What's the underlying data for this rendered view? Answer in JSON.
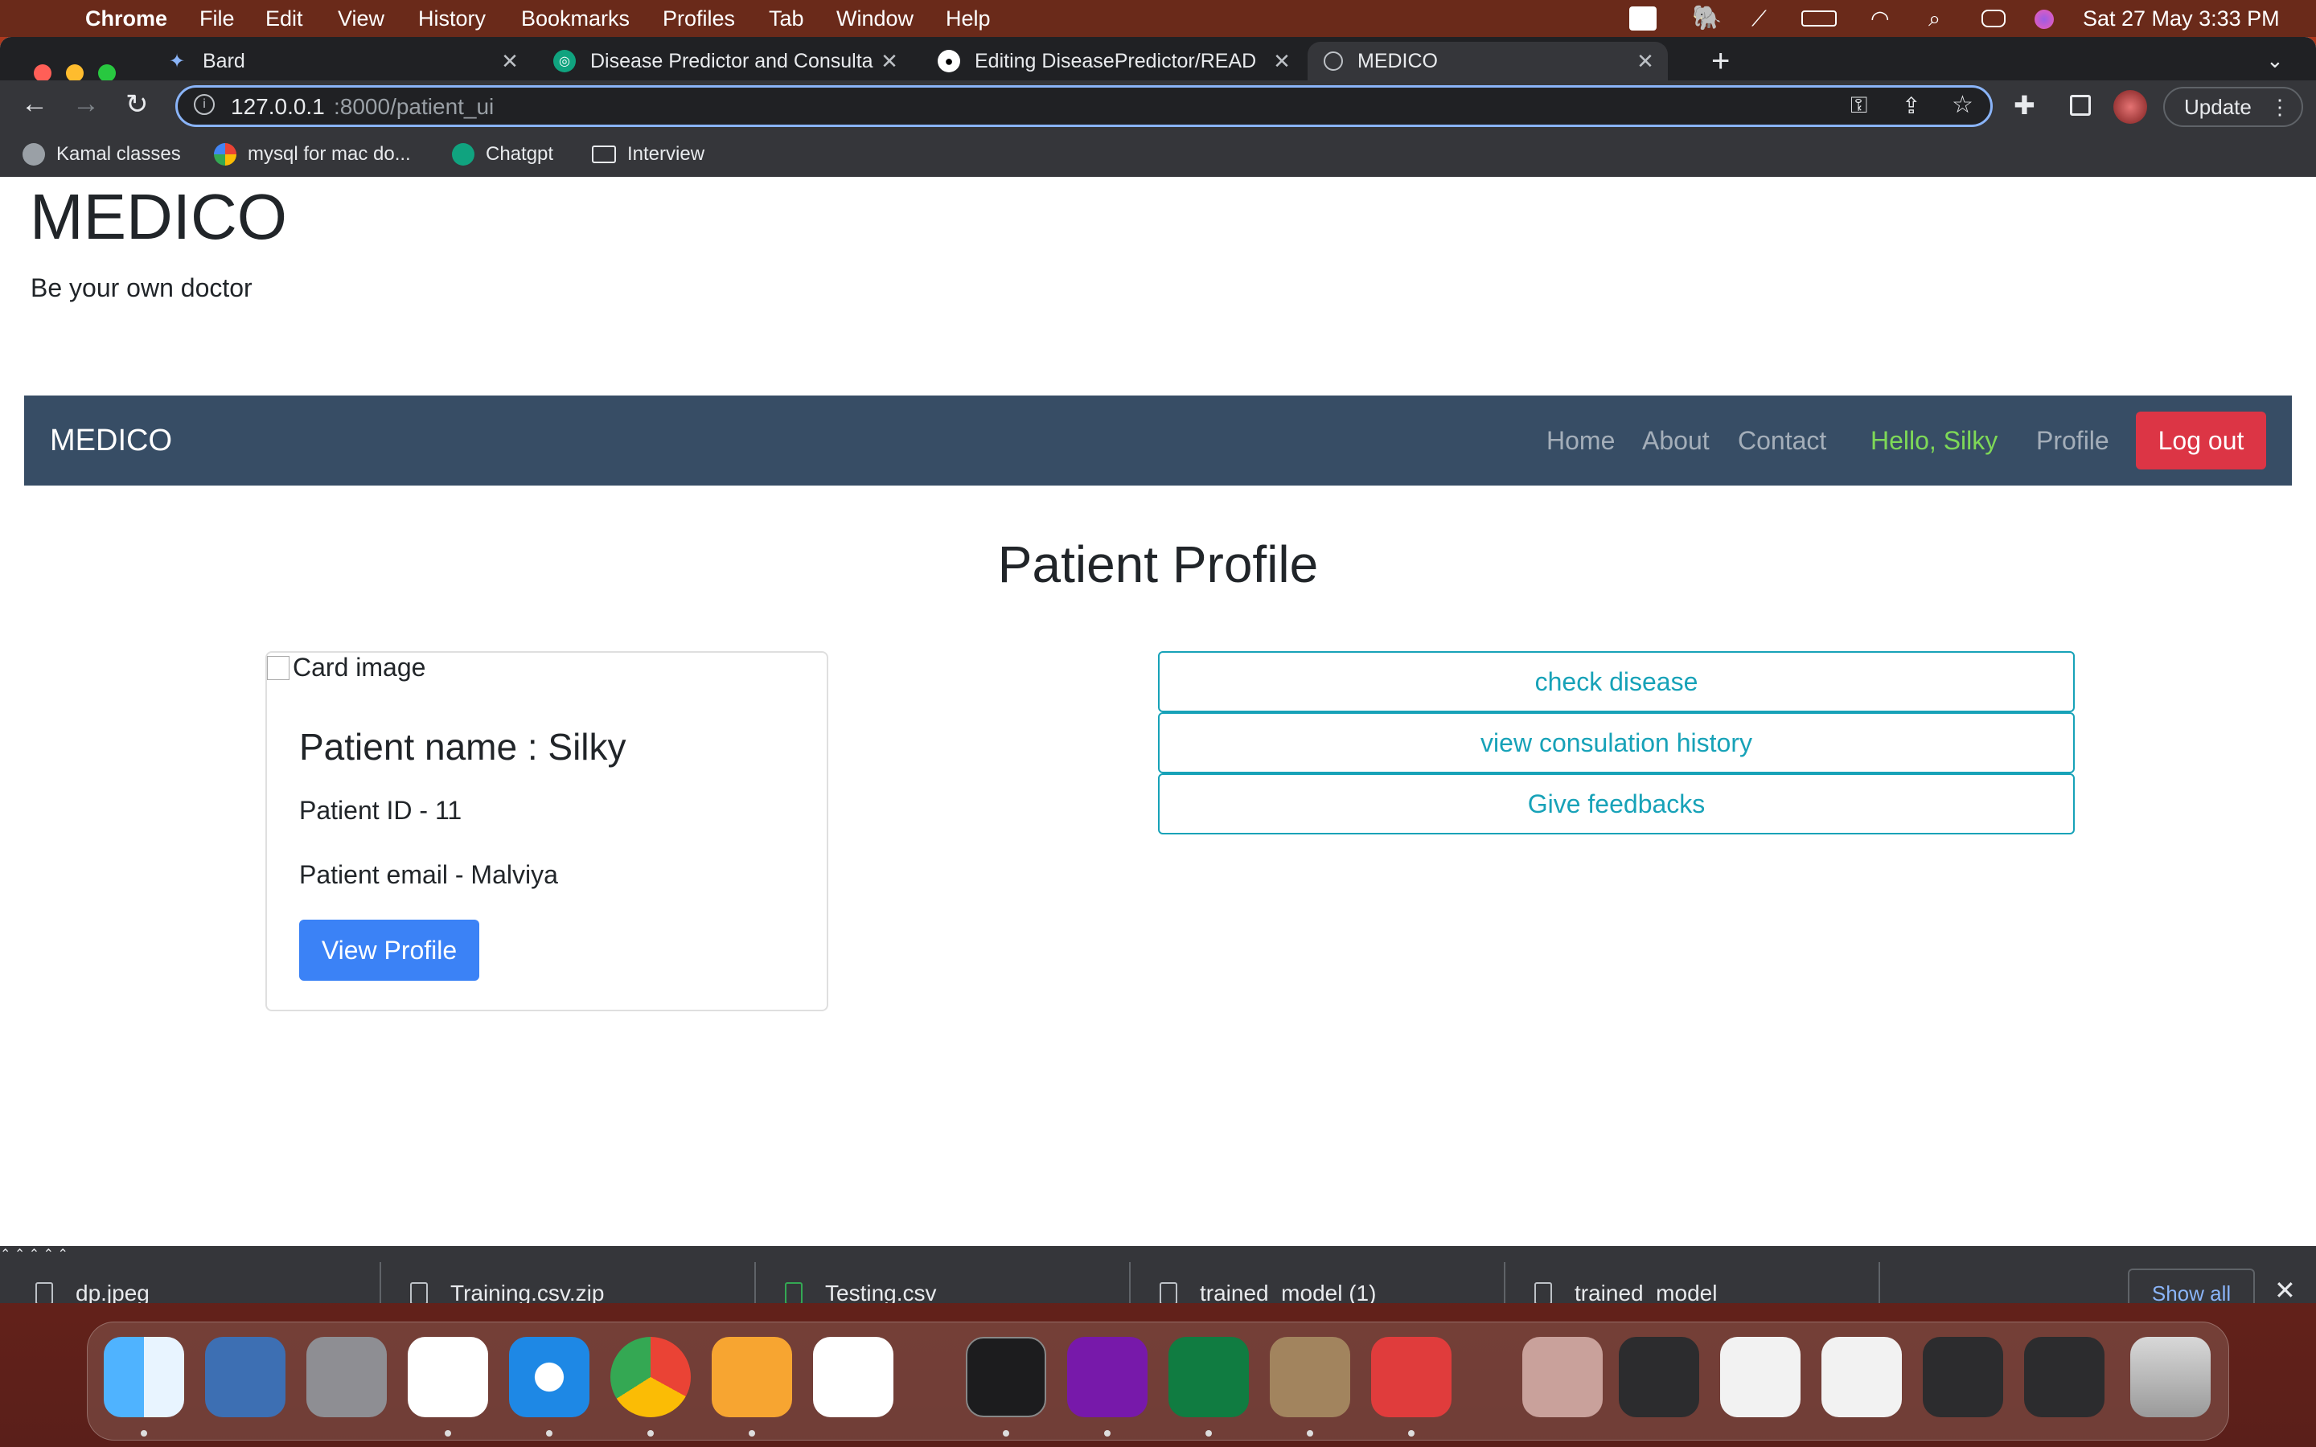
{
  "menubar": {
    "app": "Chrome",
    "items": [
      "File",
      "Edit",
      "View",
      "History",
      "Bookmarks",
      "Profiles",
      "Tab",
      "Window",
      "Help"
    ],
    "clock": "Sat 27 May  3:33 PM"
  },
  "tabs": [
    {
      "title": "Bard",
      "icon": "bard-sparkle-icon"
    },
    {
      "title": "Disease Predictor and Consulta",
      "icon": "chatgpt-icon"
    },
    {
      "title": "Editing DiseasePredictor/READ",
      "icon": "github-icon"
    },
    {
      "title": "MEDICO",
      "icon": "globe-icon"
    }
  ],
  "omnibox": {
    "host": "127.0.0.1",
    "path": ":8000/patient_ui"
  },
  "toolbar": {
    "update_label": "Update"
  },
  "bookmarks": [
    "Kamal classes",
    "mysql for mac do...",
    "Chatgpt",
    "Interview"
  ],
  "site": {
    "title": "MEDICO",
    "tagline": "Be your own doctor"
  },
  "navbar": {
    "brand": "MEDICO",
    "links": [
      "Home",
      "About",
      "Contact"
    ],
    "greeting": "Hello, Silky",
    "profile": "Profile",
    "logout": "Log out"
  },
  "main": {
    "heading": "Patient Profile",
    "card": {
      "image_alt": "Card image",
      "name": "Patient name : Silky",
      "id": "Patient ID - 11",
      "email": "Patient email - Malviya",
      "button": "View Profile"
    },
    "actions": [
      "check disease",
      "view consulation history",
      "Give feedbacks"
    ]
  },
  "downloads": {
    "items": [
      "dp.jpeg",
      "Training.csv.zip",
      "Testing.csv",
      "trained_model (1)",
      "trained_model"
    ],
    "show_all": "Show all"
  },
  "colors": {
    "navbar": "#374d65",
    "greeting": "#7ed957",
    "logout": "#dc3545",
    "primary": "#3b82f6",
    "outline": "#17a2b8"
  }
}
